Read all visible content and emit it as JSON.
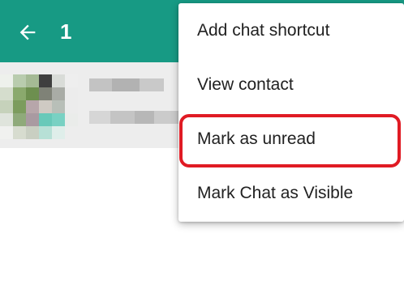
{
  "toolbar": {
    "selected_count": "1",
    "back_icon": "arrow-left-icon",
    "background_color": "#179a84"
  },
  "chat_row": {
    "background_color": "#ededed",
    "avatar": "pixelated-avatar"
  },
  "context_menu": {
    "items": [
      {
        "label": "Add chat shortcut"
      },
      {
        "label": "View contact"
      },
      {
        "label": "Mark as unread"
      },
      {
        "label": "Mark Chat as Visible"
      }
    ],
    "highlighted_item": "Mark as unread",
    "highlight_color": "#e01b24"
  }
}
